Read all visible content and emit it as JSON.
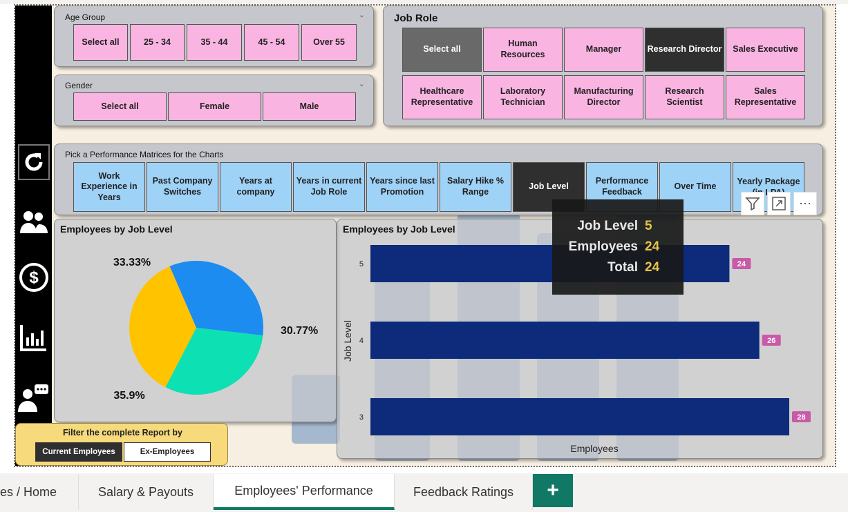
{
  "age_group": {
    "title": "Age Group",
    "options": [
      "Select all",
      "25 - 34",
      "35 - 44",
      "45 - 54",
      "Over 55"
    ]
  },
  "gender": {
    "title": "Gender",
    "options": [
      "Select all",
      "Female",
      "Male"
    ]
  },
  "job_role": {
    "title": "Job Role",
    "options": [
      "Select all",
      "Human Resources",
      "Manager",
      "Research Director",
      "Sales Executive",
      "Healthcare Representative",
      "Laboratory Technician",
      "Manufacturing Director",
      "Research Scientist",
      "Sales Representative"
    ],
    "selected": [
      "Research Director"
    ]
  },
  "metric_picker": {
    "title": "Pick a Performance Matrices for the Charts",
    "options": [
      "Work Experience in Years",
      "Past Company Switches",
      "Years at company",
      "Years in current Job Role",
      "Years since last Promotion",
      "Salary Hike % Range",
      "Job Level",
      "Performance Feedback",
      "Over Time",
      "Yearly Package (in LPA)"
    ],
    "selected": "Job Level"
  },
  "pie_chart": {
    "title": "Employees by Job Level"
  },
  "bar_chart": {
    "title": "Employees by Job Level"
  },
  "tooltip": {
    "rows": [
      {
        "label": "Job Level",
        "value": "5"
      },
      {
        "label": "Employees",
        "value": "24"
      },
      {
        "label": "Total",
        "value": "24"
      }
    ]
  },
  "filter": {
    "label": "Filter the complete Report by",
    "current": "Current Employees",
    "ex": "Ex-Employees"
  },
  "tabs": [
    {
      "label": "es / Home"
    },
    {
      "label": "Salary & Payouts"
    },
    {
      "label": "Employees' Performance"
    },
    {
      "label": "Feedback Ratings"
    }
  ],
  "add_tab": "+",
  "rail_icons": [
    "refresh-icon",
    "people-icon",
    "dollar-icon",
    "bar-chart-icon",
    "feedback-icon"
  ],
  "colors": {
    "pink": "#f9b4e1",
    "blue": "#9fd2f7",
    "selected": "#2f2f2f",
    "bar": "#0d2b7a",
    "badge": "#c85aa8",
    "tab_accent": "#117865",
    "pie": [
      "#1c8cf0",
      "#0de0b2",
      "#ffc300"
    ]
  },
  "chart_data": [
    {
      "type": "pie",
      "title": "Employees by Job Level",
      "slices": [
        {
          "label": "33.33%",
          "value": 33.33,
          "color": "#1c8cf0"
        },
        {
          "label": "30.77%",
          "value": 30.77,
          "color": "#0de0b2"
        },
        {
          "label": "35.9%",
          "value": 35.9,
          "color": "#ffc300"
        }
      ]
    },
    {
      "type": "bar",
      "title": "Employees by Job Level",
      "orientation": "horizontal",
      "categories": [
        "5",
        "4",
        "3"
      ],
      "values": [
        24,
        26,
        28
      ],
      "xlabel": "Employees",
      "ylabel": "Job Level",
      "xlim": [
        0,
        28
      ]
    }
  ]
}
